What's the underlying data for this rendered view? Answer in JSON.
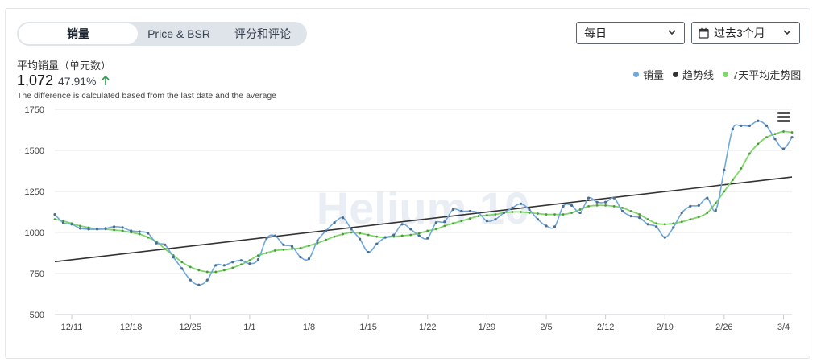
{
  "tabs": [
    {
      "label": "销量",
      "active": true
    },
    {
      "label": "Price & BSR",
      "active": false
    },
    {
      "label": "评分和评论",
      "active": false
    }
  ],
  "controls": {
    "granularity": "每日",
    "range": "过去3个月",
    "range_icon": "calendar-icon"
  },
  "metric": {
    "label": "平均销量（单元数）",
    "value": "1,072",
    "change": "47.91%",
    "change_direction": "up"
  },
  "note": "The difference is calculated based from the last date and the average",
  "colors": {
    "sales": "#6fa8dc",
    "trend": "#333333",
    "avg7": "#7fd66a",
    "up_arrow": "#2e9c4e"
  },
  "chart_data": {
    "type": "line",
    "watermark": "Helium 10",
    "legend": [
      "销量",
      "趋势线",
      "7天平均走势图"
    ],
    "legend_position": "top-right",
    "grid": true,
    "ylim": [
      500,
      1750
    ],
    "yticks": [
      500,
      750,
      1000,
      1250,
      1500,
      1750
    ],
    "x_ticks": [
      {
        "label": "12/11",
        "date": "2023-12-11"
      },
      {
        "label": "12/18",
        "date": "2023-12-18"
      },
      {
        "label": "12/25",
        "date": "2023-12-25"
      },
      {
        "label": "1/1",
        "date": "2024-01-01"
      },
      {
        "label": "1/8",
        "date": "2024-01-08"
      },
      {
        "label": "1/15",
        "date": "2024-01-15"
      },
      {
        "label": "1/22",
        "date": "2024-01-22"
      },
      {
        "label": "1/29",
        "date": "2024-01-29"
      },
      {
        "label": "2/5",
        "date": "2024-02-05"
      },
      {
        "label": "2/12",
        "date": "2024-02-12"
      },
      {
        "label": "2/19",
        "date": "2024-02-19"
      },
      {
        "label": "2/26",
        "date": "2024-02-26"
      },
      {
        "label": "3/4",
        "date": "2024-03-04"
      }
    ],
    "series": [
      {
        "name": "销量",
        "dates": [
          "2023-12-09",
          "2023-12-10",
          "2023-12-11",
          "2023-12-12",
          "2023-12-13",
          "2023-12-14",
          "2023-12-15",
          "2023-12-16",
          "2023-12-17",
          "2023-12-18",
          "2023-12-19",
          "2023-12-20",
          "2023-12-21",
          "2023-12-22",
          "2023-12-23",
          "2023-12-24",
          "2023-12-25",
          "2023-12-26",
          "2023-12-27",
          "2023-12-28",
          "2023-12-29",
          "2023-12-30",
          "2023-12-31",
          "2024-01-01",
          "2024-01-02",
          "2024-01-03",
          "2024-01-04",
          "2024-01-05",
          "2024-01-06",
          "2024-01-07",
          "2024-01-08",
          "2024-01-09",
          "2024-01-10",
          "2024-01-11",
          "2024-01-12",
          "2024-01-13",
          "2024-01-14",
          "2024-01-15",
          "2024-01-16",
          "2024-01-17",
          "2024-01-18",
          "2024-01-19",
          "2024-01-20",
          "2024-01-21",
          "2024-01-22",
          "2024-01-23",
          "2024-01-24",
          "2024-01-25",
          "2024-01-26",
          "2024-01-27",
          "2024-01-28",
          "2024-01-29",
          "2024-01-30",
          "2024-01-31",
          "2024-02-01",
          "2024-02-02",
          "2024-02-03",
          "2024-02-04",
          "2024-02-05",
          "2024-02-06",
          "2024-02-07",
          "2024-02-08",
          "2024-02-09",
          "2024-02-10",
          "2024-02-11",
          "2024-02-12",
          "2024-02-13",
          "2024-02-14",
          "2024-02-15",
          "2024-02-16",
          "2024-02-17",
          "2024-02-18",
          "2024-02-19",
          "2024-02-20",
          "2024-02-21",
          "2024-02-22",
          "2024-02-23",
          "2024-02-24",
          "2024-02-25",
          "2024-02-26",
          "2024-02-27",
          "2024-02-28",
          "2024-02-29",
          "2024-03-01",
          "2024-03-02",
          "2024-03-03",
          "2024-03-04",
          "2024-03-05"
        ],
        "values": [
          1110,
          1060,
          1050,
          1025,
          1020,
          1020,
          1025,
          1035,
          1030,
          1010,
          1005,
          995,
          935,
          925,
          850,
          780,
          710,
          680,
          710,
          800,
          800,
          820,
          830,
          810,
          835,
          965,
          980,
          925,
          915,
          850,
          840,
          950,
          1010,
          1060,
          1090,
          1020,
          960,
          880,
          930,
          970,
          985,
          1050,
          1020,
          980,
          965,
          1060,
          1065,
          1140,
          1130,
          1130,
          1120,
          1070,
          1080,
          1120,
          1150,
          1175,
          1140,
          1080,
          1040,
          1035,
          1160,
          1165,
          1120,
          1210,
          1185,
          1185,
          1210,
          1130,
          1100,
          1090,
          1050,
          1035,
          970,
          1030,
          1120,
          1160,
          1165,
          1210,
          1135,
          1380,
          1630,
          1650,
          1650,
          1680,
          1650,
          1570,
          1510,
          1580
        ]
      },
      {
        "name": "7天平均走势图",
        "dates": [
          "2023-12-09",
          "2023-12-10",
          "2023-12-11",
          "2023-12-12",
          "2023-12-13",
          "2023-12-14",
          "2023-12-15",
          "2023-12-16",
          "2023-12-17",
          "2023-12-18",
          "2023-12-19",
          "2023-12-20",
          "2023-12-21",
          "2023-12-22",
          "2023-12-23",
          "2023-12-24",
          "2023-12-25",
          "2023-12-26",
          "2023-12-27",
          "2023-12-28",
          "2023-12-29",
          "2023-12-30",
          "2023-12-31",
          "2024-01-01",
          "2024-01-02",
          "2024-01-03",
          "2024-01-04",
          "2024-01-05",
          "2024-01-06",
          "2024-01-07",
          "2024-01-08",
          "2024-01-09",
          "2024-01-10",
          "2024-01-11",
          "2024-01-12",
          "2024-01-13",
          "2024-01-14",
          "2024-01-15",
          "2024-01-16",
          "2024-01-17",
          "2024-01-18",
          "2024-01-19",
          "2024-01-20",
          "2024-01-21",
          "2024-01-22",
          "2024-01-23",
          "2024-01-24",
          "2024-01-25",
          "2024-01-26",
          "2024-01-27",
          "2024-01-28",
          "2024-01-29",
          "2024-01-30",
          "2024-01-31",
          "2024-02-01",
          "2024-02-02",
          "2024-02-03",
          "2024-02-04",
          "2024-02-05",
          "2024-02-06",
          "2024-02-07",
          "2024-02-08",
          "2024-02-09",
          "2024-02-10",
          "2024-02-11",
          "2024-02-12",
          "2024-02-13",
          "2024-02-14",
          "2024-02-15",
          "2024-02-16",
          "2024-02-17",
          "2024-02-18",
          "2024-02-19",
          "2024-02-20",
          "2024-02-21",
          "2024-02-22",
          "2024-02-23",
          "2024-02-24",
          "2024-02-25",
          "2024-02-26",
          "2024-02-27",
          "2024-02-28",
          "2024-02-29",
          "2024-03-01",
          "2024-03-02",
          "2024-03-03",
          "2024-03-04",
          "2024-03-05"
        ],
        "values": [
          1080,
          1070,
          1055,
          1040,
          1030,
          1020,
          1020,
          1015,
          1010,
          1000,
          990,
          970,
          945,
          900,
          860,
          820,
          790,
          770,
          760,
          760,
          770,
          785,
          805,
          830,
          860,
          875,
          890,
          895,
          900,
          905,
          920,
          935,
          955,
          975,
          990,
          1000,
          995,
          985,
          975,
          970,
          975,
          980,
          985,
          995,
          1010,
          1020,
          1040,
          1055,
          1070,
          1085,
          1100,
          1105,
          1110,
          1120,
          1125,
          1125,
          1120,
          1115,
          1110,
          1110,
          1110,
          1120,
          1140,
          1160,
          1165,
          1165,
          1160,
          1150,
          1130,
          1110,
          1080,
          1055,
          1050,
          1055,
          1065,
          1080,
          1095,
          1120,
          1180,
          1250,
          1320,
          1390,
          1480,
          1540,
          1580,
          1600,
          1615,
          1610,
          1590,
          1575,
          1580
        ]
      },
      {
        "name": "趋势线",
        "dates": [
          "2023-12-09",
          "2024-03-05"
        ],
        "values": [
          822,
          1338
        ]
      }
    ]
  }
}
